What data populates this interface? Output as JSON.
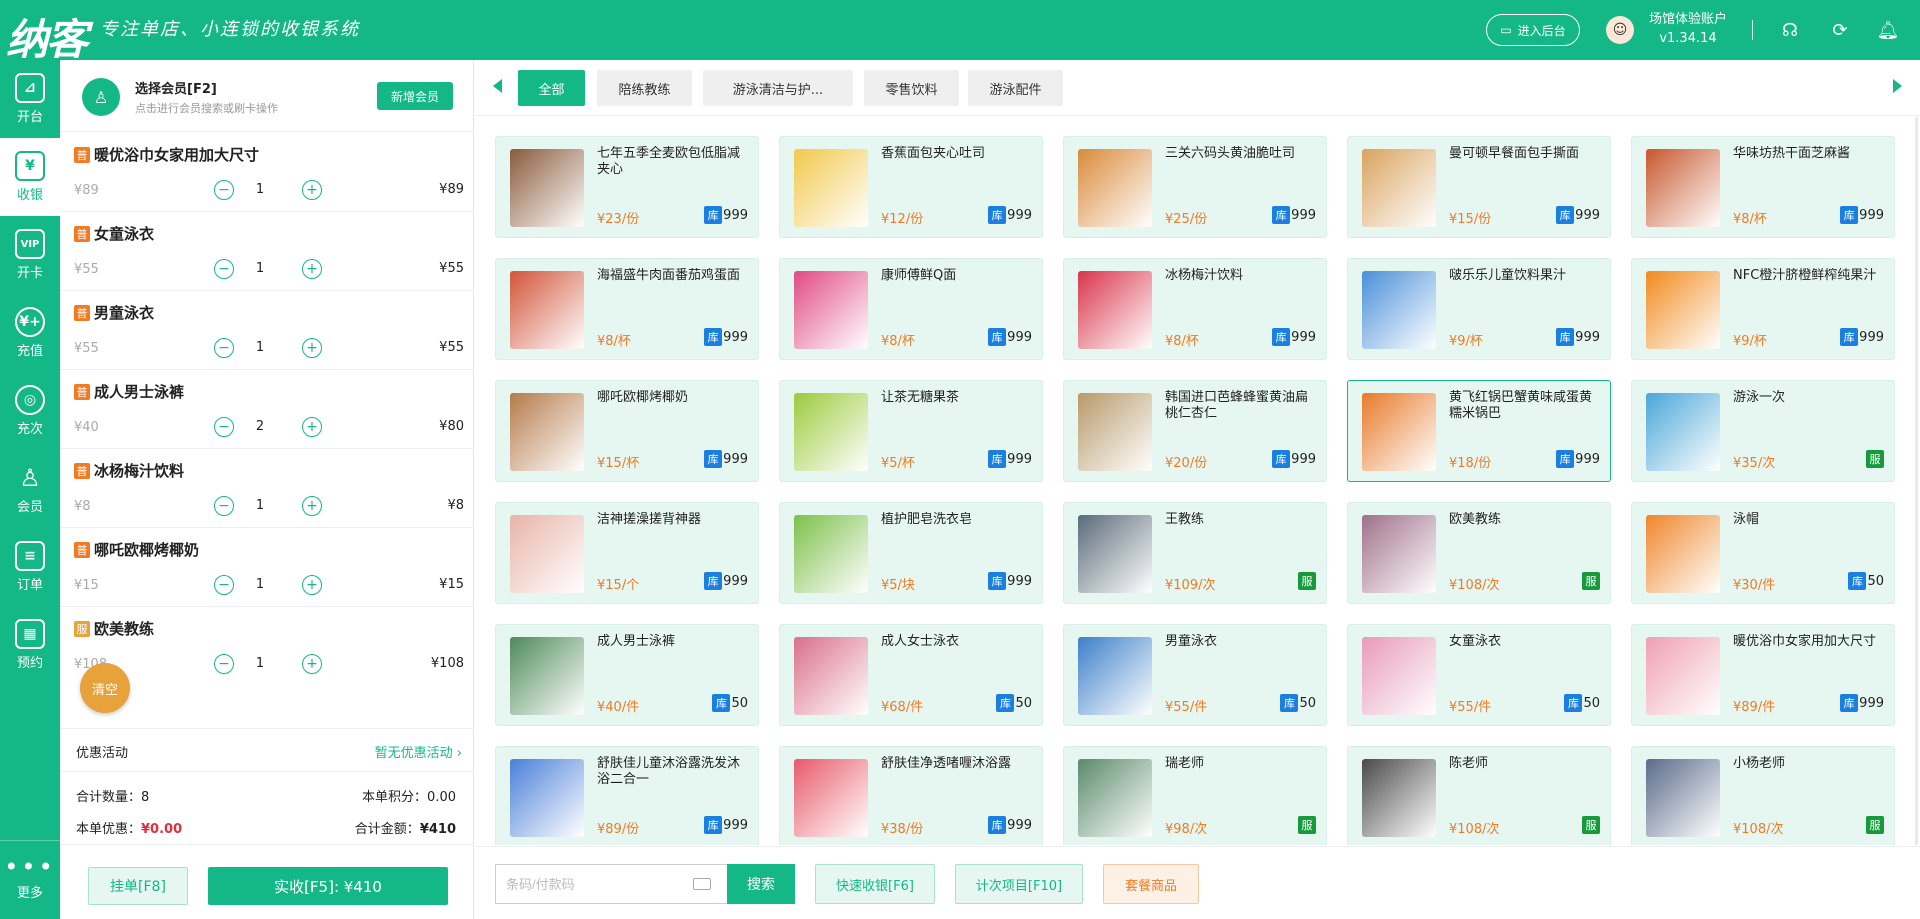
{
  "header": {
    "logo": "纳客",
    "slogan": "专注单店、小连锁的收银系统",
    "backend_button": "进入后台",
    "account_name": "场馆体验账户",
    "version": "v1.34.14",
    "brand_color": "#14b886"
  },
  "nav": [
    {
      "label": "开台",
      "icon": "table-icon",
      "glyph": "⊿"
    },
    {
      "label": "收银",
      "icon": "cashier-icon",
      "glyph": "¥"
    },
    {
      "label": "开卡",
      "icon": "vip-card-icon",
      "glyph": "VIP"
    },
    {
      "label": "充值",
      "icon": "recharge-icon",
      "glyph": "¥+"
    },
    {
      "label": "充次",
      "icon": "recharge-times-icon",
      "glyph": "◎"
    },
    {
      "label": "会员",
      "icon": "member-icon",
      "glyph": "♙"
    },
    {
      "label": "订单",
      "icon": "order-icon",
      "glyph": "≡"
    },
    {
      "label": "预约",
      "icon": "booking-icon",
      "glyph": "▦"
    }
  ],
  "nav_more": "更多",
  "member": {
    "title": "选择会员[F2]",
    "subtitle": "点击进行会员搜索或刷卡操作",
    "add_button": "新增会员"
  },
  "cart": {
    "items": [
      {
        "tag": "普",
        "name": "暖优浴巾女家用加大尺寸",
        "price": "¥89",
        "qty": "1",
        "subtotal": "¥89"
      },
      {
        "tag": "普",
        "name": "女童泳衣",
        "price": "¥55",
        "qty": "1",
        "subtotal": "¥55"
      },
      {
        "tag": "普",
        "name": "男童泳衣",
        "price": "¥55",
        "qty": "1",
        "subtotal": "¥55"
      },
      {
        "tag": "普",
        "name": "成人男士泳裤",
        "price": "¥40",
        "qty": "2",
        "subtotal": "¥80"
      },
      {
        "tag": "普",
        "name": "冰杨梅汁饮料",
        "price": "¥8",
        "qty": "1",
        "subtotal": "¥8"
      },
      {
        "tag": "普",
        "name": "哪吒欧椰烤椰奶",
        "price": "¥15",
        "qty": "1",
        "subtotal": "¥15"
      },
      {
        "tag": "服",
        "name": "欧美教练",
        "price": "¥108",
        "qty": "1",
        "subtotal": "¥108"
      }
    ],
    "clear_button": "清空",
    "promo_label": "优惠活动",
    "promo_value": "暂无优惠活动",
    "total_qty_label": "合计数量：",
    "total_qty": "8",
    "points_label": "本单积分：",
    "points": "0.00",
    "discount_label": "本单优惠：",
    "discount": "¥0.00",
    "total_label": "合计金额：",
    "total": "¥410",
    "hold_button": "挂单[F8]",
    "pay_button": "实收[F5]:  ¥410"
  },
  "categories": [
    "全部",
    "陪练教练",
    "游泳清洁与护...",
    "零售饮料",
    "游泳配件"
  ],
  "products": [
    {
      "name": "七年五季全麦欧包低脂减夹心",
      "price": "¥23/份",
      "kind": "stock",
      "stock": "999",
      "color": "#8a5a3c"
    },
    {
      "name": "香蕉面包夹心吐司",
      "price": "¥12/份",
      "kind": "stock",
      "stock": "999",
      "color": "#f2c84b"
    },
    {
      "name": "三关六码头黄油脆吐司",
      "price": "¥25/份",
      "kind": "stock",
      "stock": "999",
      "color": "#d98a3a"
    },
    {
      "name": "曼可顿早餐面包手撕面",
      "price": "¥15/份",
      "kind": "stock",
      "stock": "999",
      "color": "#d9a35e"
    },
    {
      "name": "华味坊热干面芝麻酱",
      "price": "¥8/杯",
      "kind": "stock",
      "stock": "999",
      "color": "#c8562e"
    },
    {
      "name": "海福盛牛肉面番茄鸡蛋面",
      "price": "¥8/杯",
      "kind": "stock",
      "stock": "999",
      "color": "#d2543a"
    },
    {
      "name": "康师傅鲜Q面",
      "price": "¥8/杯",
      "kind": "stock",
      "stock": "999",
      "color": "#e14a83"
    },
    {
      "name": "冰杨梅汁饮料",
      "price": "¥8/杯",
      "kind": "stock",
      "stock": "999",
      "color": "#d9344a"
    },
    {
      "name": "啵乐乐儿童饮料果汁",
      "price": "¥9/杯",
      "kind": "stock",
      "stock": "999",
      "color": "#4a8fd9"
    },
    {
      "name": "NFC橙汁脐橙鲜榨纯果汁",
      "price": "¥9/杯",
      "kind": "stock",
      "stock": "999",
      "color": "#f28a1e"
    },
    {
      "name": "哪吒欧椰烤椰奶",
      "price": "¥15/杯",
      "kind": "stock",
      "stock": "999",
      "color": "#b57a4a"
    },
    {
      "name": "让茶无糖果茶",
      "price": "¥5/杯",
      "kind": "stock",
      "stock": "999",
      "color": "#9ccb3d"
    },
    {
      "name": "韩国进口芭蜂蜂蜜黄油扁桃仁杏仁",
      "price": "¥20/份",
      "kind": "stock",
      "stock": "999",
      "color": "#b89a6a"
    },
    {
      "name": "黄飞红锅巴蟹黄味咸蛋黄糯米锅巴",
      "price": "¥18/份",
      "kind": "stock",
      "stock": "999",
      "color": "#e87a2a"
    },
    {
      "name": "游泳一次",
      "price": "¥35/次",
      "kind": "service",
      "stock": "",
      "color": "#4aa6d9"
    },
    {
      "name": "洁神搓澡搓背神器",
      "price": "¥15/个",
      "kind": "stock",
      "stock": "999",
      "color": "#e8b4a8"
    },
    {
      "name": "植护肥皂洗衣皂",
      "price": "¥5/块",
      "kind": "stock",
      "stock": "999",
      "color": "#7cc14a"
    },
    {
      "name": "王教练",
      "price": "¥109/次",
      "kind": "service",
      "stock": "",
      "color": "#5b6b7a"
    },
    {
      "name": "欧美教练",
      "price": "¥108/次",
      "kind": "service",
      "stock": "",
      "color": "#a0708a"
    },
    {
      "name": "泳帽",
      "price": "¥30/件",
      "kind": "stock",
      "stock": "50",
      "color": "#f0862a"
    },
    {
      "name": "成人男士泳裤",
      "price": "¥40/件",
      "kind": "stock",
      "stock": "50",
      "color": "#4e8a5a"
    },
    {
      "name": "成人女士泳衣",
      "price": "¥68/件",
      "kind": "stock",
      "stock": "50",
      "color": "#d9708a"
    },
    {
      "name": "男童泳衣",
      "price": "¥55/件",
      "kind": "stock",
      "stock": "50",
      "color": "#3d7fc9"
    },
    {
      "name": "女童泳衣",
      "price": "¥55/件",
      "kind": "stock",
      "stock": "50",
      "color": "#e89ab8"
    },
    {
      "name": "暖优浴巾女家用加大尺寸",
      "price": "¥89/件",
      "kind": "stock",
      "stock": "999",
      "color": "#f0a0b0"
    },
    {
      "name": "舒肤佳儿童沐浴露洗发沐浴二合一",
      "price": "¥89/份",
      "kind": "stock",
      "stock": "999",
      "color": "#4a7fd9"
    },
    {
      "name": "舒肤佳净透啫喱沐浴露",
      "price": "¥38/份",
      "kind": "stock",
      "stock": "999",
      "color": "#e85a6a"
    },
    {
      "name": "瑞老师",
      "price": "¥98/次",
      "kind": "service",
      "stock": "",
      "color": "#5a8a6a"
    },
    {
      "name": "陈老师",
      "price": "¥108/次",
      "kind": "service",
      "stock": "",
      "color": "#4a4a4a"
    },
    {
      "name": "小杨老师",
      "price": "¥108/次",
      "kind": "service",
      "stock": "",
      "color": "#5a6a8a"
    }
  ],
  "stock_tag": "库",
  "service_tag": "服",
  "bottom": {
    "search_placeholder": "条码/付款码",
    "search_button": "搜索",
    "quick_cashier": "快速收银[F6]",
    "count_items": "计次项目[F10]",
    "combo": "套餐商品"
  }
}
